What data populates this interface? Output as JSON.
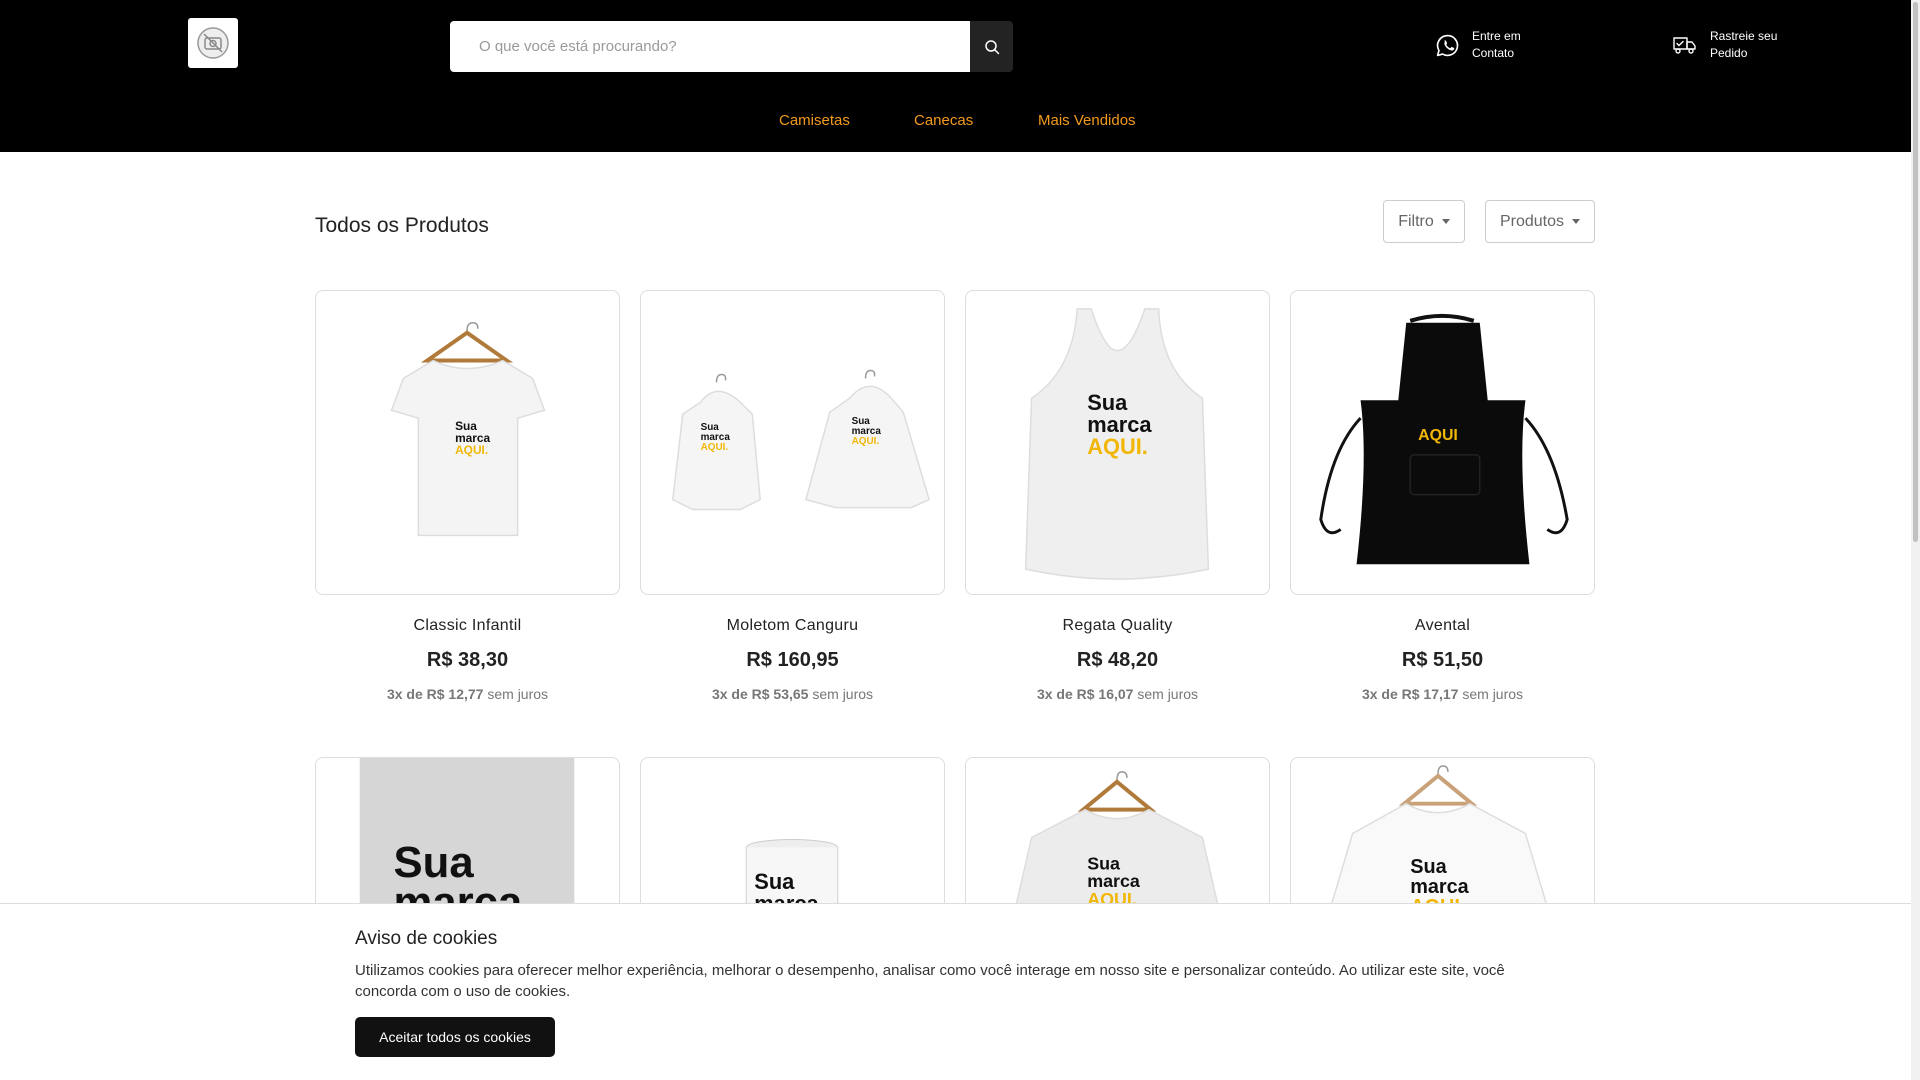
{
  "header": {
    "logo_alt": "logo",
    "search": {
      "placeholder": "O que você está procurando?",
      "value": ""
    },
    "contact_line1": "Entre em",
    "contact_line2": "Contato",
    "track_line1": "Rastreie seu",
    "track_line2": "Pedido"
  },
  "nav": {
    "items": [
      {
        "label": "Camisetas"
      },
      {
        "label": "Canecas"
      },
      {
        "label": "Mais Vendidos"
      }
    ]
  },
  "main": {
    "title": "Todos os Produtos",
    "filter_label": "Filtro",
    "products_label": "Produtos"
  },
  "products": [
    {
      "name": "Classic Infantil",
      "price": "R$ 38,30",
      "inst_bold": "3x de R$ 12,77",
      "inst_rest": " sem juros"
    },
    {
      "name": "Moletom Canguru",
      "price": "R$ 160,95",
      "inst_bold": "3x de R$ 53,65",
      "inst_rest": " sem juros"
    },
    {
      "name": "Regata Quality",
      "price": "R$ 48,20",
      "inst_bold": "3x de R$ 16,07",
      "inst_rest": " sem juros"
    },
    {
      "name": "Avental",
      "price": "R$ 51,50",
      "inst_bold": "3x de R$ 17,17",
      "inst_rest": " sem juros"
    }
  ],
  "mockup_text": {
    "line1": "Sua",
    "line2": "marca",
    "line3": "AQUI.",
    "apron": "AQUI"
  },
  "cookie": {
    "title": "Aviso de cookies",
    "text": "Utilizamos cookies para oferecer melhor experiência, melhorar o desempenho, analisar como você interage em nosso site e personalizar conteúdo. Ao utilizar este site, você concorda com o uso de cookies.",
    "accept_label": "Aceitar todos os cookies"
  },
  "colors": {
    "header_bg": "#000000",
    "nav_link": "#f39a1e",
    "brand_yellow": "#f2b705"
  }
}
